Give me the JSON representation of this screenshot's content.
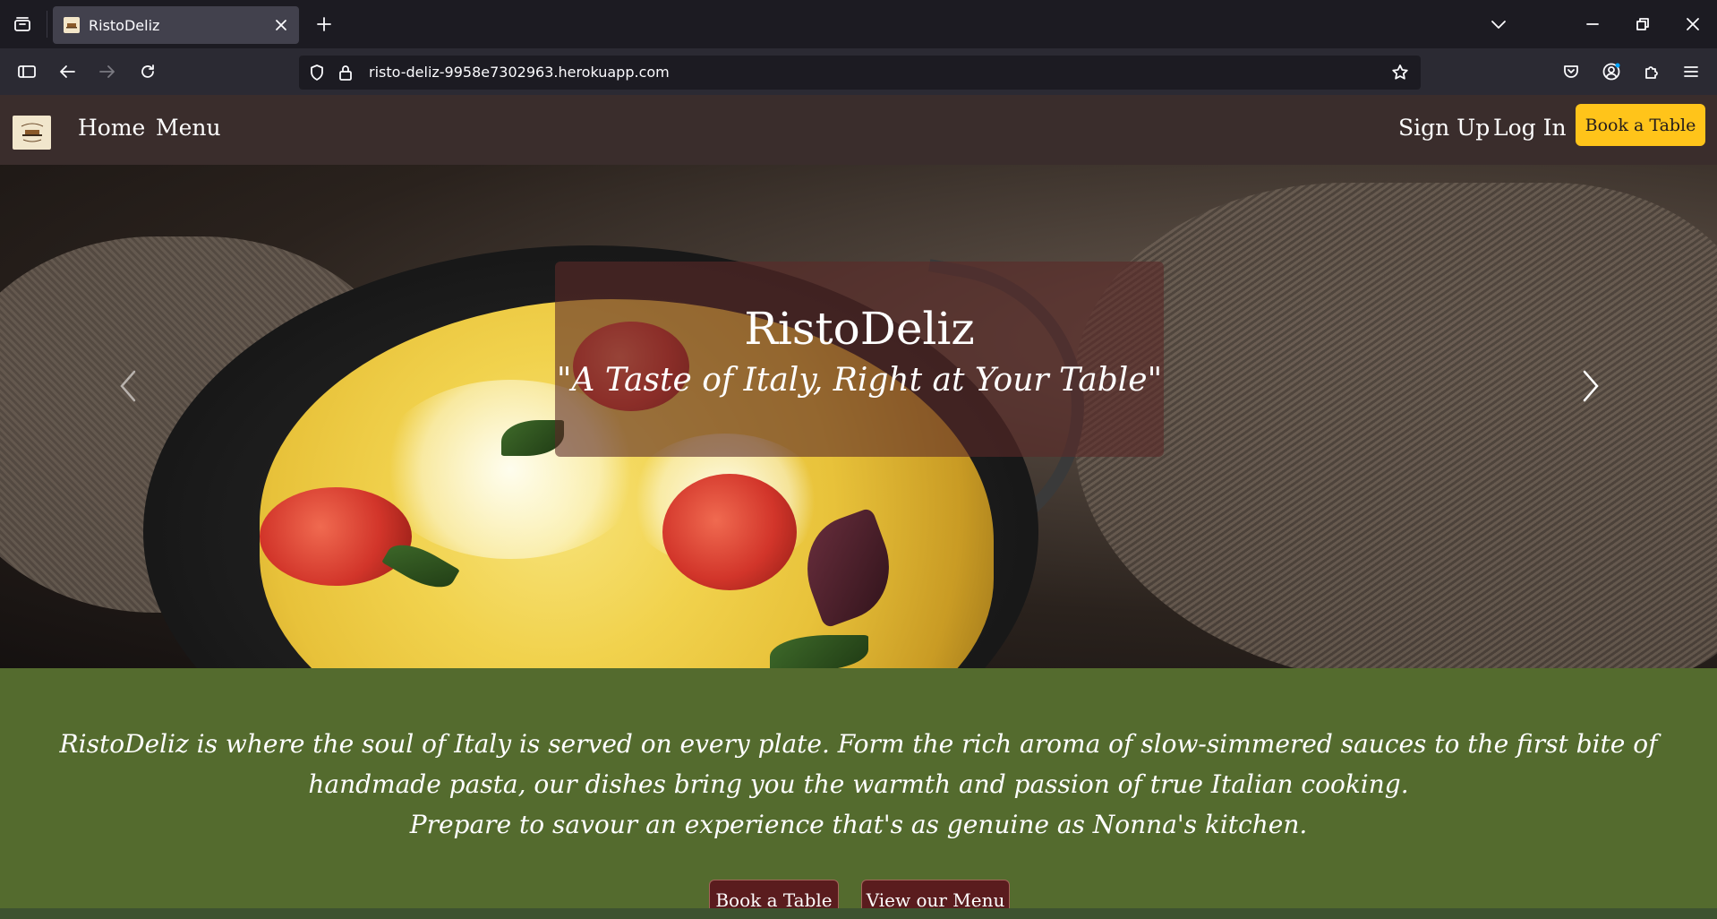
{
  "browser": {
    "tab_title": "RistoDeliz",
    "url": "risto-deliz-9958e7302963.herokuapp.com"
  },
  "site": {
    "nav": {
      "home": "Home",
      "menu": "Menu",
      "sign_up": "Sign Up",
      "log_in": "Log In",
      "book_table": "Book a Table"
    },
    "hero": {
      "title": "RistoDeliz",
      "subtitle": "\"A Taste of Italy, Right at Your Table\""
    },
    "intro": {
      "line1": "RistoDeliz is where the soul of Italy is served on every plate. Form the rich aroma of slow-simmered sauces to the first bite of",
      "line2": "handmade pasta, our dishes bring you the warmth and passion of true Italian cooking.",
      "line3": "Prepare to savour an experience that's as genuine as Nonna's kitchen.",
      "book_button": "Book a Table",
      "menu_button": "View our Menu"
    }
  },
  "colors": {
    "header_bg": "#3a2d2c",
    "accent_button": "#ffc41a",
    "intro_bg": "#546b2e",
    "intro_button_bg": "#5a1c1e"
  }
}
